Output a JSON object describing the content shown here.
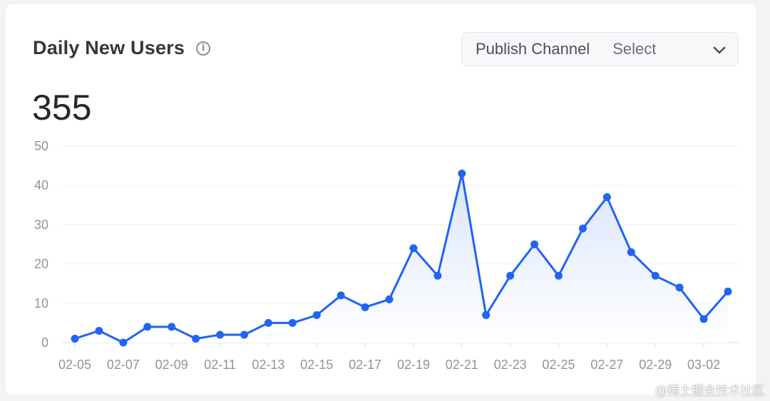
{
  "header": {
    "title": "Daily New Users",
    "info_icon": "info-icon"
  },
  "filter": {
    "label": "Publish Channel",
    "value": "Select",
    "icon": "chevron-down-icon"
  },
  "summary": {
    "total": "355"
  },
  "colors": {
    "line": "#2164f3",
    "area_top": "#d9e5fd",
    "area_bottom": "#ffffff",
    "grid": "#eef0f3"
  },
  "watermark": "@稀土掘金技术社区",
  "chart_data": {
    "type": "area",
    "title": "",
    "xlabel": "",
    "ylabel": "",
    "ylim": [
      0,
      50
    ],
    "yticks": [
      0,
      10,
      20,
      30,
      40,
      50
    ],
    "grid": true,
    "x": [
      "02-05",
      "02-06",
      "02-07",
      "02-08",
      "02-09",
      "02-10",
      "02-11",
      "02-12",
      "02-13",
      "02-14",
      "02-15",
      "02-16",
      "02-17",
      "02-18",
      "02-19",
      "02-20",
      "02-21",
      "02-22",
      "02-23",
      "02-24",
      "02-25",
      "02-26",
      "02-27",
      "02-28",
      "02-29",
      "03-01",
      "03-02",
      "03-03"
    ],
    "xtick_labels": [
      "02-05",
      "02-07",
      "02-09",
      "02-11",
      "02-13",
      "02-15",
      "02-17",
      "02-19",
      "02-21",
      "02-23",
      "02-25",
      "02-27",
      "02-29",
      "03-02"
    ],
    "series": [
      {
        "values": [
          1,
          3,
          0,
          4,
          4,
          1,
          2,
          2,
          5,
          5,
          7,
          12,
          9,
          11,
          24,
          17,
          43,
          7,
          17,
          25,
          17,
          29,
          37,
          23,
          17,
          14,
          6,
          13
        ]
      }
    ]
  }
}
